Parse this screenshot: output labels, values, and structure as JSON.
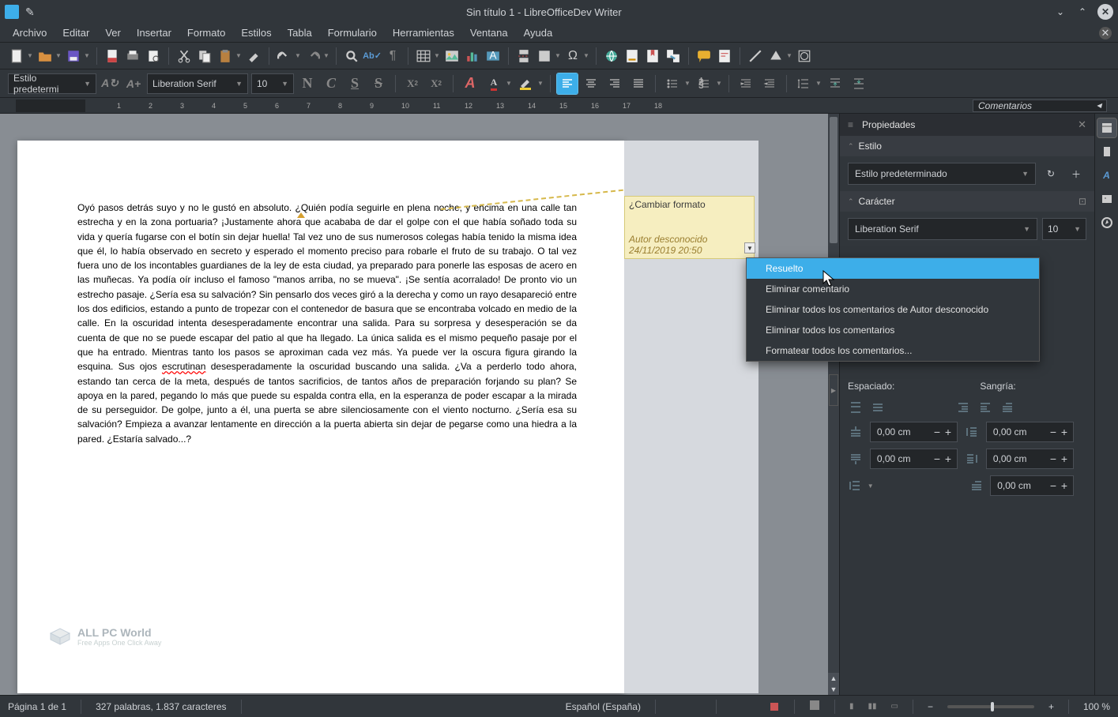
{
  "window": {
    "title": "Sin título 1 - LibreOfficeDev Writer"
  },
  "menu": {
    "items": [
      "Archivo",
      "Editar",
      "Ver",
      "Insertar",
      "Formato",
      "Estilos",
      "Tabla",
      "Formulario",
      "Herramientas",
      "Ventana",
      "Ayuda"
    ]
  },
  "format_bar": {
    "para_style": "Estilo predetermi",
    "font_name": "Liberation Serif",
    "font_size": "10"
  },
  "ruler": {
    "comments_header": "Comentarios"
  },
  "document": {
    "body": "Oyó pasos detrás suyo y no le gustó en absoluto. ¿Quién podía seguirle en plena noche, y encima en una calle tan estrecha y en la zona portuaria? ¡Justamente ahora que acababa de dar el golpe con el que había soñado toda su vida y quería fugarse con el botín sin dejar huella! Tal vez uno de sus numerosos colegas había tenido la misma idea que él, lo había observado en secreto y esperado el momento preciso para robarle el fruto de su trabajo. O tal vez fuera uno de los incontables guardianes de la ley de esta ciudad, ya preparado para ponerle las esposas de acero en las muñecas. Ya podía oír incluso el famoso  \"manos arriba, no se mueva\". ¡Se sentía acorralado! De pronto vio un estrecho pasaje. ¿Sería esa su salvación? Sin pensarlo dos veces giró a la derecha y como un rayo desapareció entre los dos edificios, estando a punto de tropezar con el contenedor de basura que se encontraba volcado en medio de la calle. En la oscuridad intenta desesperadamente encontrar una salida. Para su sorpresa y desesperación se da cuenta de que no se puede escapar del patio al que ha llegado. La única salida es el mismo pequeño pasaje por el que ha entrado. Mientras tanto los pasos se aproximan cada vez más. Ya puede ver la oscura figura girando la esquina. Sus ojos ",
    "spell_word": "escrutinan",
    "body_after": " desesperadamente la oscuridad buscando una salida. ¿Va a perderlo todo ahora, estando tan cerca de la meta, después de tantos sacrificios, de tantos años de preparación forjando su plan? Se apoya en la pared, pegando lo más que puede su espalda contra ella, en la esperanza de poder escapar a la mirada de su perseguidor. De golpe, junto a él, una puerta se abre silenciosamente con el viento nocturno. ¿Sería esa su salvación? Empieza a avanzar lentamente en dirección a la puerta abierta sin dejar de pegarse como una hiedra a la pared. ¿Estaría salvado...?"
  },
  "comment": {
    "text": "¿Cambiar formato",
    "author": "Autor desconocido",
    "date": "24/11/2019 20:50"
  },
  "context_menu": {
    "items": [
      "Resuelto",
      "Eliminar comentario",
      "Eliminar todos los comentarios de Autor desconocido",
      "Eliminar todos los comentarios",
      "Formatear todos los comentarios..."
    ]
  },
  "sidebar": {
    "title": "Propiedades",
    "sections": {
      "style": {
        "header": "Estilo",
        "combo": "Estilo predeterminado"
      },
      "character": {
        "header": "Carácter",
        "font": "Liberation Serif",
        "size": "10"
      },
      "spacing": {
        "label_spacing": "Espaciado:",
        "label_indent": "Sangría:",
        "value": "0,00 cm"
      }
    }
  },
  "statusbar": {
    "page": "Página 1 de 1",
    "words": "327 palabras, 1.837 caracteres",
    "lang": "Español (España)",
    "zoom": "100 %"
  },
  "watermark": {
    "name": "ALL PC World",
    "sub": "Free Apps One Click Away"
  }
}
